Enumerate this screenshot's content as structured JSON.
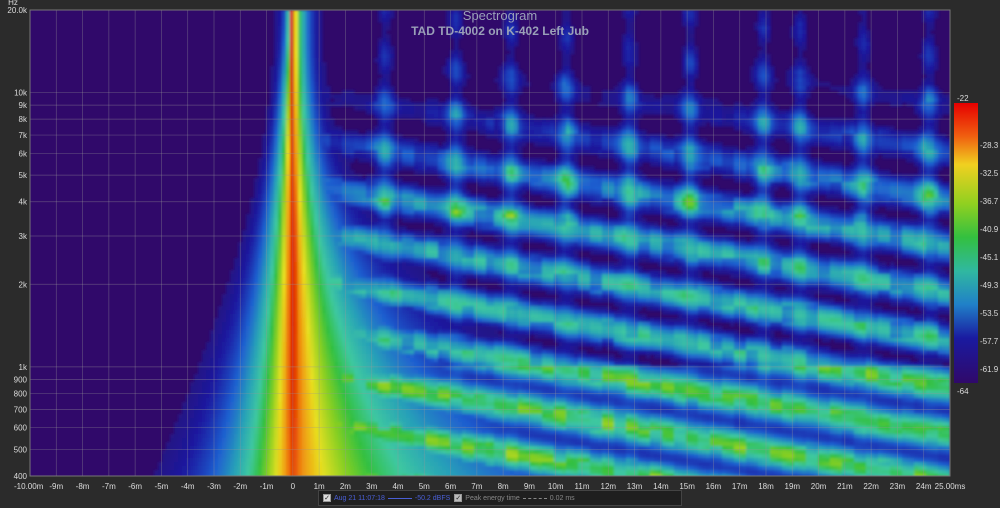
{
  "chart_data": {
    "type": "heatmap",
    "title": "Spectrogram",
    "subtitle": "TAD TD-4002  on K-402 Left Jub",
    "y_unit": "Hz",
    "x_unit": "ms",
    "xlim": [
      -10,
      25
    ],
    "ylim": [
      400,
      20000
    ],
    "y_scale": "log",
    "x_ticks": [
      -10,
      -9,
      -8,
      -7,
      -6,
      -5,
      -4,
      -3,
      -2,
      -1,
      0,
      1,
      2,
      3,
      4,
      5,
      6,
      7,
      8,
      9,
      10,
      11,
      12,
      13,
      14,
      15,
      16,
      17,
      18,
      19,
      20,
      21,
      22,
      23,
      24,
      25
    ],
    "x_tick_labels": [
      "-10.00m",
      "-9m",
      "-8m",
      "-7m",
      "-6m",
      "-5m",
      "-4m",
      "-3m",
      "-2m",
      "-1m",
      "0",
      "1m",
      "2m",
      "3m",
      "4m",
      "5m",
      "6m",
      "7m",
      "8m",
      "9m",
      "10m",
      "11m",
      "12m",
      "13m",
      "14m",
      "15m",
      "16m",
      "17m",
      "18m",
      "19m",
      "20m",
      "21m",
      "22m",
      "23m",
      "24m",
      "25.00ms"
    ],
    "y_ticks": [
      20000,
      10000,
      9000,
      8000,
      7000,
      6000,
      5000,
      4000,
      3000,
      2000,
      1000,
      900,
      800,
      700,
      600,
      500,
      400
    ],
    "y_tick_labels": [
      "20.0k",
      "10k",
      "9k",
      "8k",
      "7k",
      "6k",
      "5k",
      "4k",
      "3k",
      "2k",
      "1k",
      "900",
      "800",
      "700",
      "600",
      "500",
      "400"
    ],
    "colorbar": {
      "min": -64,
      "max": -22,
      "ticks": [
        -22,
        -28.3,
        -32.5,
        -36.7,
        -40.9,
        -45.1,
        -49.3,
        -53.5,
        -57.7,
        -61.9,
        -64
      ],
      "tick_labels": [
        "-22",
        "-28.3",
        "-32.5",
        "-36.7",
        "-40.9",
        "-45.1",
        "-49.3",
        "-53.5",
        "-57.7",
        "-61.9",
        "-64"
      ]
    },
    "grid": true,
    "legend_placement": "bottom-center",
    "colors": {
      "background": "#2b2b2b",
      "plot_floor": "#30096a",
      "colormap": [
        "#30096a",
        "#1a1aa0",
        "#1f5fd0",
        "#27a0b8",
        "#3ec8a0",
        "#33c040",
        "#8ed020",
        "#e8e020",
        "#f09010",
        "#e02000",
        "#e60000"
      ]
    },
    "features": {
      "ridge_time_ms": 0,
      "ridge_width_ms": 0.9,
      "reflection_times_ms": [
        3.5,
        6.2,
        8.3,
        10.4,
        12.8,
        15.1,
        17.9,
        19.3,
        21.7,
        24.2
      ]
    }
  },
  "legend": {
    "items": [
      {
        "label": "Aug 21 11:07:18",
        "checked": true
      },
      {
        "label": "-50.2 dBFS",
        "checked": false
      },
      {
        "label": "Peak energy time",
        "checked": true
      },
      {
        "label": "0.02 ms",
        "checked": false
      }
    ],
    "line_colors": [
      "#4a5fd6",
      "#888888"
    ]
  }
}
